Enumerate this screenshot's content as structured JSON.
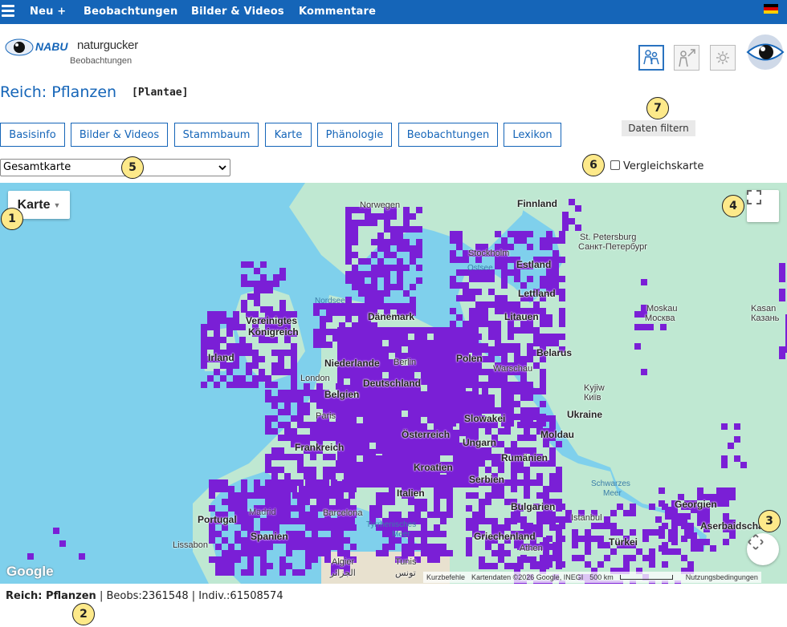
{
  "nav": {
    "items": [
      "Neu +",
      "Beobachtungen",
      "Bilder & Videos",
      "Kommentare"
    ]
  },
  "logo": {
    "brand": "NABU",
    "name": "naturgucker",
    "subtitle": "Beobachtungen"
  },
  "page": {
    "title": "Reich: Pflanzen",
    "scientific": "[Plantae]"
  },
  "tabs": [
    "Basisinfo",
    "Bilder & Videos",
    "Stammbaum",
    "Karte",
    "Phänologie",
    "Beobachtungen",
    "Lexikon"
  ],
  "filter_button": "Daten filtern",
  "map_select": {
    "value": "Gesamtkarte"
  },
  "compare": {
    "label": "Vergleichskarte",
    "checked": false
  },
  "map": {
    "type_button": "Karte",
    "labels": {
      "finnland": "Finnland",
      "norwegen": "Norwegen",
      "stpete": "St. Petersburg",
      "stpete_ru": "Санкт-Петербург",
      "stockholm": "Stockholm",
      "ostsee": "Ostsee",
      "estland": "Estland",
      "lettland": "Lettland",
      "nordsee": "Nordsee",
      "moskau": "Moskau",
      "moskau_ru": "Москва",
      "kasan": "Kasan",
      "kasan_ru": "Казань",
      "uk1": "Vereinigtes",
      "uk2": "Königreich",
      "irland": "Irland",
      "daenemark": "Dänemark",
      "litauen": "Litauen",
      "polen": "Polen",
      "belarus": "Belarus",
      "niederlande": "Niederlande",
      "berlin": "Berlin",
      "london": "London",
      "deutschland": "Deutschland",
      "warschau": "Warschau",
      "belgien": "Belgien",
      "kyjiw": "Kyjiw",
      "kyjiw_ua": "Київ",
      "ukraine": "Ukraine",
      "paris": "Paris",
      "slowakei": "Slowakei",
      "frankreich": "Frankreich",
      "oesterreich": "Österreich",
      "ungarn": "Ungarn",
      "moldau": "Moldau",
      "rumaenien": "Rumänien",
      "kroatien": "Kroatien",
      "serbien": "Serbien",
      "schwarzes1": "Schwarzes",
      "schwarzes2": "Meer",
      "portugal": "Portugal",
      "italien": "Italien",
      "bulgarien": "Bulgarien",
      "georgien": "Georgien",
      "barcelona": "Barcelona",
      "istanbul": "Istanbul",
      "spanien": "Spanien",
      "tyrrh1": "Tyrrhenisches",
      "tyrrh2": "Meer",
      "griechenland": "Griechenland",
      "aserbaidschan": "Aserbaidschan",
      "lissabon": "Lissabon",
      "athen": "Athen",
      "tuerkei": "Türkei",
      "algier": "Algier",
      "algier_ar": "الجزائر",
      "tunis": "Tunis",
      "tunis_ar": "تونس",
      "madrid": "Madrid"
    },
    "google": "Google",
    "attribution": {
      "shortcuts": "Kurzbefehle",
      "data": "Kartendaten ©2026 Google, INEGI",
      "scale": "500 km",
      "terms": "Nutzungsbedingungen"
    }
  },
  "footer": {
    "name": "Reich: Pflanzen",
    "beobs": "| Beobs:2361548 |",
    "indiv": "Indiv.:61508574"
  },
  "badges": [
    "1",
    "2",
    "3",
    "4",
    "5",
    "6",
    "7"
  ],
  "colors": {
    "nav": "#1565b8",
    "heatmap": "#7a1fd6",
    "sea": "#7fd0ec",
    "land": "#bde7cf",
    "badge": "#fde98a"
  }
}
